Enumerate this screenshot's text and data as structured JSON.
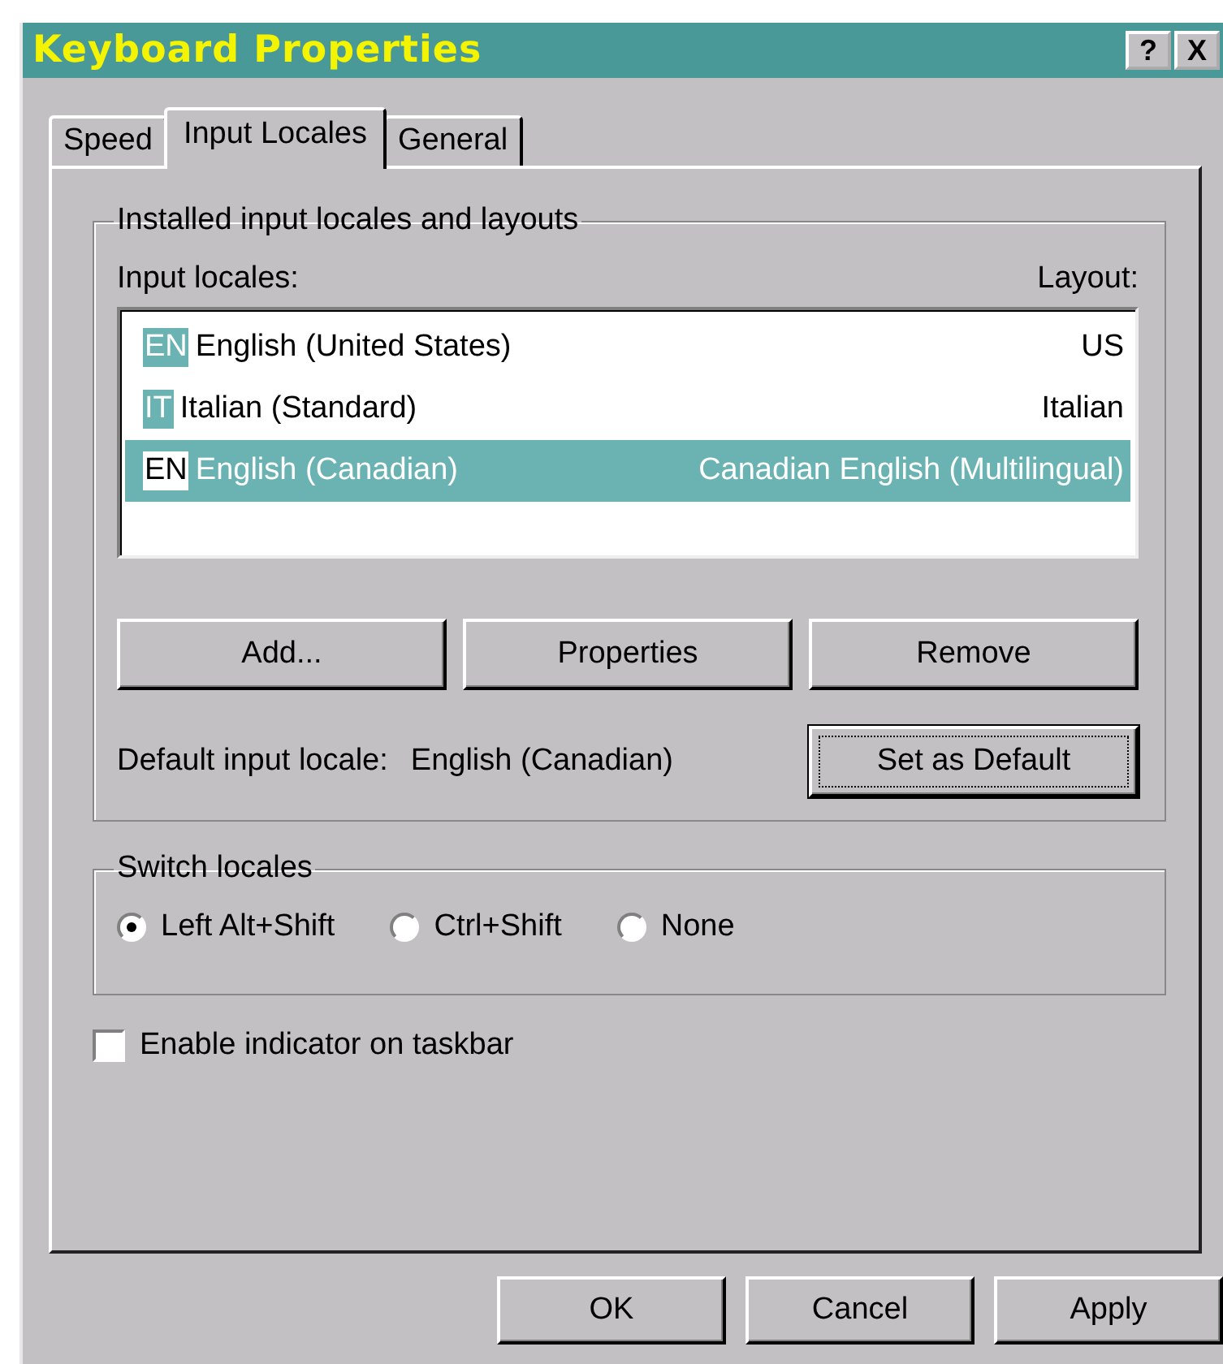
{
  "window": {
    "title": "Keyboard Properties",
    "title_buttons": [
      "?",
      "X"
    ]
  },
  "tabs": [
    {
      "label": "Speed",
      "selected": false
    },
    {
      "label": "Input Locales",
      "selected": true
    },
    {
      "label": "General",
      "selected": false
    }
  ],
  "locales_group": {
    "title": "Installed input locales and layouts",
    "list_header": "Input locales:",
    "layout_header": "Layout:",
    "locales": [
      {
        "code": "EN",
        "name": "English (United States)",
        "layout": "US",
        "selected": false
      },
      {
        "code": "IT",
        "name": "Italian (Standard)",
        "layout": "Italian",
        "selected": false
      },
      {
        "code": "EN",
        "name": "English (Canadian)",
        "layout": "Canadian English (Multilingual)",
        "selected": true
      }
    ],
    "buttons": [
      {
        "label": "Add..."
      },
      {
        "label": "Properties"
      },
      {
        "label": "Remove"
      }
    ],
    "default_label": "Default input locale:",
    "default_value": "English (Canadian)",
    "set_default": {
      "label": "Set as Default",
      "focused": true
    }
  },
  "switch_group": {
    "title": "Switch locales",
    "options": [
      {
        "label": "Left Alt+Shift",
        "selected": true
      },
      {
        "label": "Ctrl+Shift",
        "selected": false
      },
      {
        "label": "None",
        "selected": false
      }
    ]
  },
  "indicator": {
    "label": "Enable indicator on taskbar",
    "checked": false
  },
  "footer_buttons": [
    {
      "label": "OK"
    },
    {
      "label": "Cancel"
    },
    {
      "label": "Apply"
    }
  ]
}
